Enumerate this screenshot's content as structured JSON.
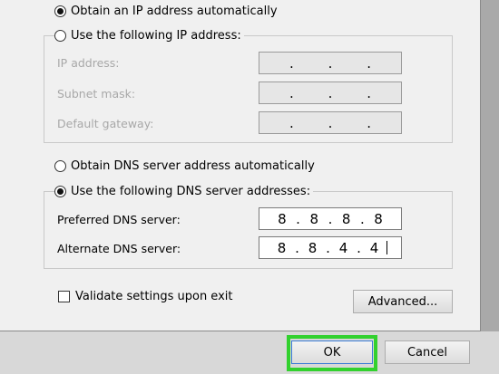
{
  "ip": {
    "obtain_auto_label": "Obtain an IP address automatically",
    "use_following_label": "Use the following IP address:",
    "ip_address_label": "IP address:",
    "subnet_mask_label": "Subnet mask:",
    "default_gateway_label": "Default gateway:",
    "dots": "."
  },
  "dns": {
    "obtain_auto_label": "Obtain DNS server address automatically",
    "use_following_label": "Use the following DNS server addresses:",
    "preferred_label": "Preferred DNS server:",
    "alternate_label": "Alternate DNS server:",
    "preferred_octets": [
      "8",
      "8",
      "8",
      "8"
    ],
    "alternate_octets": [
      "8",
      "8",
      "4",
      "4"
    ]
  },
  "validate_label": "Validate settings upon exit",
  "buttons": {
    "advanced": "Advanced...",
    "ok": "OK",
    "cancel": "Cancel"
  },
  "colors": {
    "highlight": "#32d12e",
    "panel": "#f0f0f0"
  }
}
